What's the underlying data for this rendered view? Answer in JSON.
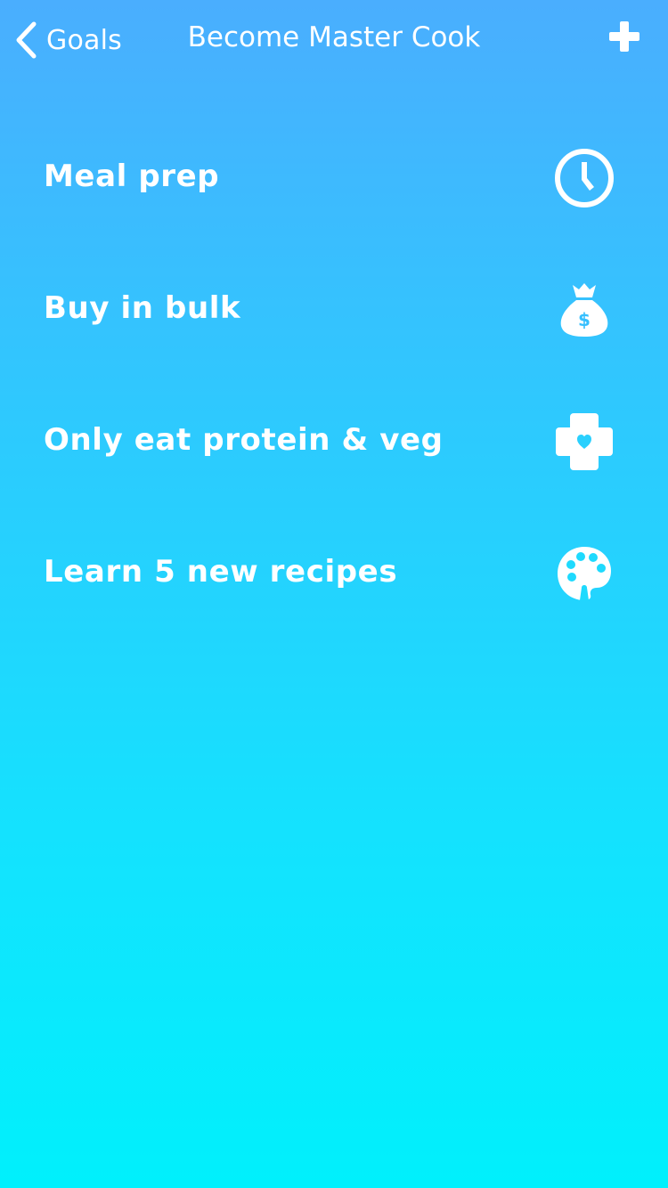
{
  "nav": {
    "back_label": "Goals",
    "title": "Become Master Cook",
    "add_icon": "plus-icon",
    "back_icon": "chevron-left-icon"
  },
  "goals": [
    {
      "label": "Meal prep",
      "icon": "clock-icon"
    },
    {
      "label": "Buy in bulk",
      "icon": "money-bag-icon"
    },
    {
      "label": "Only eat protein & veg",
      "icon": "health-cross-icon"
    },
    {
      "label": "Learn 5 new recipes",
      "icon": "palette-icon"
    }
  ],
  "colors": {
    "gradient_top": "#4aaefe",
    "gradient_bottom": "#00f0fc",
    "text": "#ffffff"
  }
}
